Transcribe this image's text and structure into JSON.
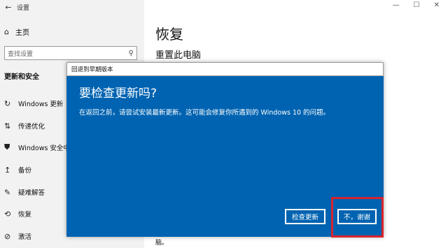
{
  "window": {
    "app_title": "设置",
    "controls": [
      "—",
      "☐",
      "✕"
    ]
  },
  "sidebar": {
    "home_label": "主页",
    "search_placeholder": "查找设置",
    "section_title": "更新和安全",
    "items": [
      {
        "label": "Windows 更新",
        "icon": "refresh-icon"
      },
      {
        "label": "传递优化",
        "icon": "delivery-icon"
      },
      {
        "label": "Windows 安全中心",
        "icon": "shield-icon"
      },
      {
        "label": "备份",
        "icon": "backup-icon"
      },
      {
        "label": "疑难解答",
        "icon": "wrench-icon"
      },
      {
        "label": "恢复",
        "icon": "recovery-icon"
      },
      {
        "label": "激活",
        "icon": "activation-icon"
      }
    ]
  },
  "main": {
    "title": "恢复",
    "subtitle": "重置此电脑",
    "footer_fragment": "脑。"
  },
  "dialog": {
    "title": "回退到早期版本",
    "heading": "要检查更新吗?",
    "body": "在返回之前，请尝试安装最新更新。这可能会修复你所遇到的 Windows 10 的问题。",
    "check_button": "检查更新",
    "no_button": "不，谢谢",
    "accent": "#0063b1",
    "highlight_color": "#d9232d"
  }
}
